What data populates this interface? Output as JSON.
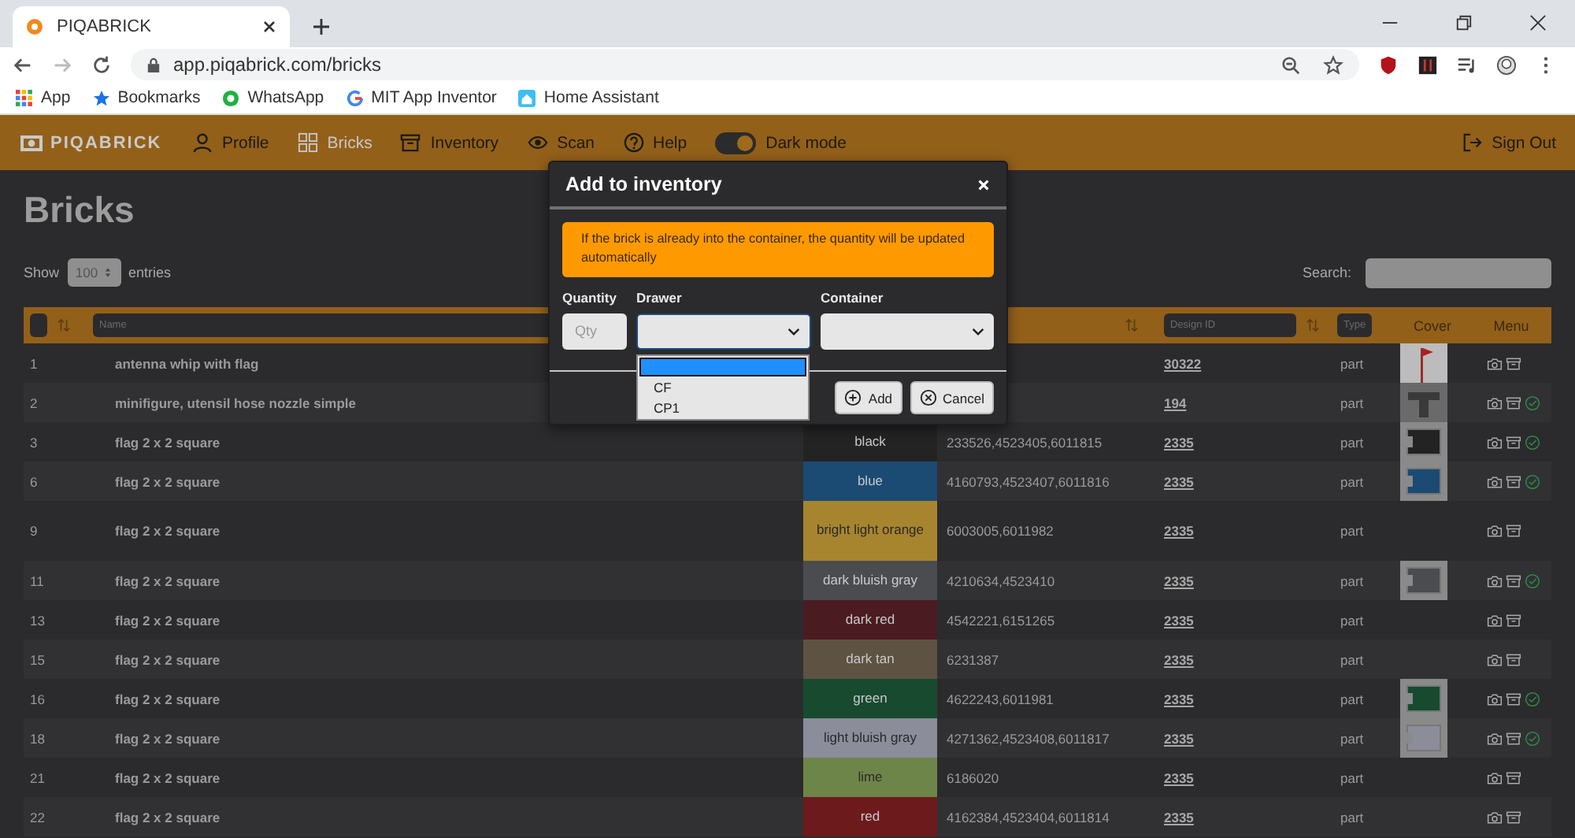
{
  "browser": {
    "tab": {
      "title": "PIQABRICK"
    },
    "url": "app.piqabrick.com/bricks",
    "bookmarks": [
      {
        "label": "App",
        "kind": "apps"
      },
      {
        "label": "Bookmarks",
        "kind": "star"
      },
      {
        "label": "WhatsApp",
        "kind": "chat"
      },
      {
        "label": "MIT App Inventor",
        "kind": "google"
      },
      {
        "label": "Home Assistant",
        "kind": "home"
      }
    ]
  },
  "navbar": {
    "logo": "PIQABRICK",
    "items": [
      {
        "label": "Profile",
        "kind": "person",
        "selected": false
      },
      {
        "label": "Bricks",
        "kind": "grid",
        "selected": true
      },
      {
        "label": "Inventory",
        "kind": "box",
        "selected": false
      },
      {
        "label": "Scan",
        "kind": "eye",
        "selected": false
      },
      {
        "label": "Help",
        "kind": "help",
        "selected": false
      }
    ],
    "dark_mode": {
      "label": "Dark mode",
      "on": true
    },
    "sign_out": "Sign Out"
  },
  "page": {
    "title": "Bricks",
    "show_label": "Show",
    "entries_value": "100",
    "entries_label": "entries",
    "search_label": "Search:"
  },
  "table": {
    "header": {
      "name_placeholder": "Name",
      "design_placeholder": "Design ID",
      "type_placeholder": "Type",
      "cover": "Cover",
      "menu": "Menu"
    },
    "rows": [
      {
        "num": "1",
        "name": "antenna whip with flag",
        "design_id": "30322",
        "type": "part",
        "has_cover": true,
        "verified": false
      },
      {
        "num": "2",
        "name": "minifigure, utensil hose nozzle simple",
        "design_id": "194",
        "type": "part",
        "has_cover": true,
        "verified": true
      },
      {
        "num": "3",
        "name": "flag 2 x 2 square",
        "color_name": "black",
        "color": "#232323",
        "element_ids": "233526,4523405,6011815",
        "design_id": "2335",
        "type": "part",
        "has_cover": true,
        "verified": true
      },
      {
        "num": "6",
        "name": "flag 2 x 2 square",
        "color_name": "blue",
        "color": "#1b4a73",
        "element_ids": "4160793,4523407,6011816",
        "design_id": "2335",
        "type": "part",
        "has_cover": true,
        "verified": true
      },
      {
        "num": "9",
        "name": "flag 2 x 2 square",
        "color_name": "bright light orange",
        "color": "#a7852f",
        "element_ids": "6003005,6011982",
        "design_id": "2335",
        "type": "part",
        "has_cover": false,
        "verified": false
      },
      {
        "num": "11",
        "name": "flag 2 x 2 square",
        "color_name": "dark bluish gray",
        "color": "#4a4c50",
        "element_ids": "4210634,4523410",
        "design_id": "2335",
        "type": "part",
        "has_cover": true,
        "verified": true
      },
      {
        "num": "13",
        "name": "flag 2 x 2 square",
        "color_name": "dark red",
        "color": "#4b1b22",
        "element_ids": "4542221,6151265",
        "design_id": "2335",
        "type": "part",
        "has_cover": false,
        "verified": false
      },
      {
        "num": "15",
        "name": "flag 2 x 2 square",
        "color_name": "dark tan",
        "color": "#5e5242",
        "element_ids": "6231387",
        "design_id": "2335",
        "type": "part",
        "has_cover": false,
        "verified": false
      },
      {
        "num": "16",
        "name": "flag 2 x 2 square",
        "color_name": "green",
        "color": "#174a2f",
        "element_ids": "4622243,6011981",
        "design_id": "2335",
        "type": "part",
        "has_cover": true,
        "verified": true
      },
      {
        "num": "18",
        "name": "flag 2 x 2 square",
        "color_name": "light bluish gray",
        "color": "#8c8d9a",
        "element_ids": "4271362,4523408,6011817",
        "design_id": "2335",
        "type": "part",
        "has_cover": true,
        "verified": true
      },
      {
        "num": "21",
        "name": "flag 2 x 2 square",
        "color_name": "lime",
        "color": "#6e8549",
        "element_ids": "6186020",
        "design_id": "2335",
        "type": "part",
        "has_cover": false,
        "verified": false
      },
      {
        "num": "22",
        "name": "flag 2 x 2 square",
        "color_name": "red",
        "color": "#6d1a1c",
        "element_ids": "4162384,4523404,6011814",
        "design_id": "2335",
        "type": "part",
        "has_cover": false,
        "verified": false
      }
    ]
  },
  "modal": {
    "title": "Add to inventory",
    "alert": "If the brick is already into the container, the quantity will be updated automatically",
    "quantity": {
      "label": "Quantity",
      "placeholder": "Qty"
    },
    "drawer": {
      "label": "Drawer",
      "open": true,
      "blank_highlighted": true,
      "options": [
        {
          "label": "CF",
          "selected": false
        },
        {
          "label": "CP1",
          "selected": false
        }
      ]
    },
    "container": {
      "label": "Container"
    },
    "buttons": [
      {
        "label": "Add",
        "kind": "add"
      },
      {
        "label": "Cancel",
        "kind": "cancel"
      }
    ]
  }
}
